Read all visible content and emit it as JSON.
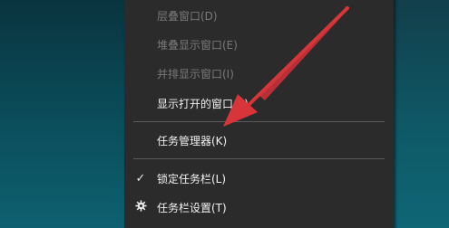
{
  "menu": {
    "items": [
      {
        "label": "层叠窗口(D)",
        "enabled": false
      },
      {
        "label": "堆叠显示窗口(E)",
        "enabled": false
      },
      {
        "label": "并排显示窗口(I)",
        "enabled": false
      },
      {
        "label": "显示打开的窗口(S)",
        "enabled": true
      },
      {
        "label": "任务管理器(K)",
        "enabled": true
      },
      {
        "label": "锁定任务栏(L)",
        "enabled": true,
        "checked": true
      },
      {
        "label": "任务栏设置(T)",
        "enabled": true,
        "icon": "gear-icon"
      }
    ]
  },
  "annotation": {
    "arrow_color": "#e03a3e"
  },
  "colors": {
    "menu_bg": "#2b2b2b",
    "desktop": "#0a5666"
  }
}
